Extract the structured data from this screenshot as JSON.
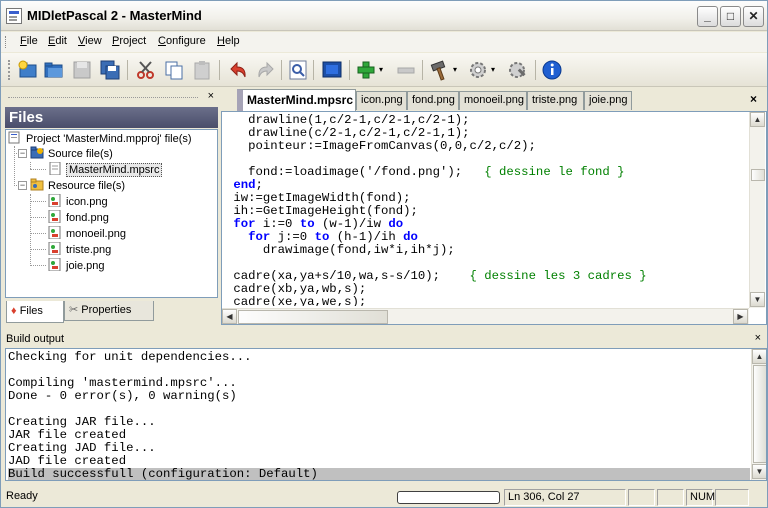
{
  "window": {
    "title": "MIDletPascal 2 - MasterMind",
    "controls": {
      "minimize": "_",
      "maximize": "□",
      "close": "✕"
    }
  },
  "menu": [
    "File",
    "Edit",
    "View",
    "Project",
    "Configure",
    "Help"
  ],
  "toolbar": {
    "icons": [
      "new-project-icon",
      "open-icon",
      "save-icon",
      "save-all-icon",
      "cut-icon",
      "copy-icon",
      "paste-icon",
      "undo-icon",
      "redo-icon",
      "find-icon",
      "fullscreen-icon",
      "add-icon",
      "remove-icon",
      "build-icon",
      "settings-icon",
      "tools-icon",
      "info-icon"
    ]
  },
  "files_pane": {
    "close": "×",
    "title": "Files",
    "tree": {
      "project": "Project 'MasterMind.mpproj' file(s)",
      "source_folder": "Source file(s)",
      "source_files": [
        "MasterMind.mpsrc"
      ],
      "resource_folder": "Resource file(s)",
      "resource_files": [
        "icon.png",
        "fond.png",
        "monoeil.png",
        "triste.png",
        "joie.png"
      ]
    },
    "tabs": {
      "files": "Files",
      "properties": "Properties"
    }
  },
  "editor": {
    "tabs": [
      "MasterMind.mpsrc",
      "icon.png",
      "fond.png",
      "monoeil.png",
      "triste.png",
      "joie.png"
    ],
    "active_tab": 0,
    "close": "×",
    "code_lines": [
      "   drawline(1,c/2-1,c/2-1,c/2-1);",
      "   drawline(c/2-1,c/2-1,c/2-1,1);",
      "   pointeur:=ImageFromCanvas(0,0,c/2,c/2);",
      "",
      "   fond:=loadimage('/fond.png');   { dessine le fond }",
      " end;",
      " iw:=getImageWidth(fond);",
      " ih:=GetImageHeight(fond);",
      " for i:=0 to (w-1)/iw do",
      "   for j:=0 to (h-1)/ih do",
      "     drawimage(fond,iw*i,ih*j);",
      "",
      " cadre(xa,ya+s/10,wa,s-s/10);    { dessine les 3 cadres }",
      " cadre(xb,ya,wb,s);",
      " cadre(xe,ya,we,s);"
    ]
  },
  "build_output": {
    "title": "Build output",
    "close": "×",
    "lines": [
      "Checking for unit dependencies...",
      "",
      "Compiling 'mastermind.mpsrc'...",
      "Done - 0 error(s), 0 warning(s)",
      "",
      "Creating JAR file...",
      "JAR file created",
      "Creating JAD file...",
      "JAD file created",
      "Build successfull (configuration: Default)"
    ],
    "highlighted_line": 9
  },
  "status": {
    "text": "Ready",
    "position": "Ln 306, Col 27",
    "num": "NUM"
  },
  "colors": {
    "keyword": "#0000ff",
    "comment": "#008000",
    "pane_title": "#4a4e6b"
  }
}
